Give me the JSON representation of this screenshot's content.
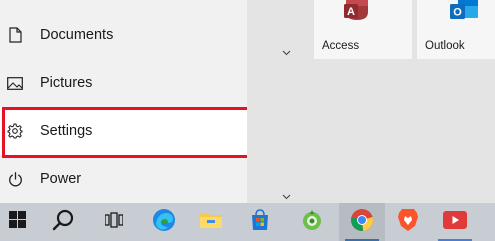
{
  "start_menu": {
    "nav": [
      {
        "label": "Documents",
        "icon": "document-icon"
      },
      {
        "label": "Pictures",
        "icon": "pictures-icon"
      },
      {
        "label": "Settings",
        "icon": "gear-icon",
        "highlighted": true
      },
      {
        "label": "Power",
        "icon": "power-icon"
      }
    ],
    "highlight_color": "#e81123"
  },
  "tiles": [
    {
      "label": "Access",
      "icon": "access-icon",
      "color": "#a4373a"
    },
    {
      "label": "Outlook",
      "icon": "outlook-icon",
      "color": "#0f6cbd"
    }
  ],
  "taskbar": {
    "items": [
      {
        "name": "start-button",
        "icon": "windows-icon"
      },
      {
        "name": "search-button",
        "icon": "search-icon"
      },
      {
        "name": "task-view-button",
        "icon": "task-view-icon"
      },
      {
        "name": "edge-button",
        "icon": "edge-icon"
      },
      {
        "name": "file-explorer-button",
        "icon": "folder-icon"
      },
      {
        "name": "store-button",
        "icon": "store-icon"
      },
      {
        "name": "app-button",
        "icon": "green-app-icon"
      },
      {
        "name": "chrome-button",
        "icon": "chrome-icon",
        "active": true
      },
      {
        "name": "brave-button",
        "icon": "brave-icon"
      },
      {
        "name": "youtube-button",
        "icon": "youtube-icon"
      }
    ],
    "accent": "#3c6ea8"
  }
}
